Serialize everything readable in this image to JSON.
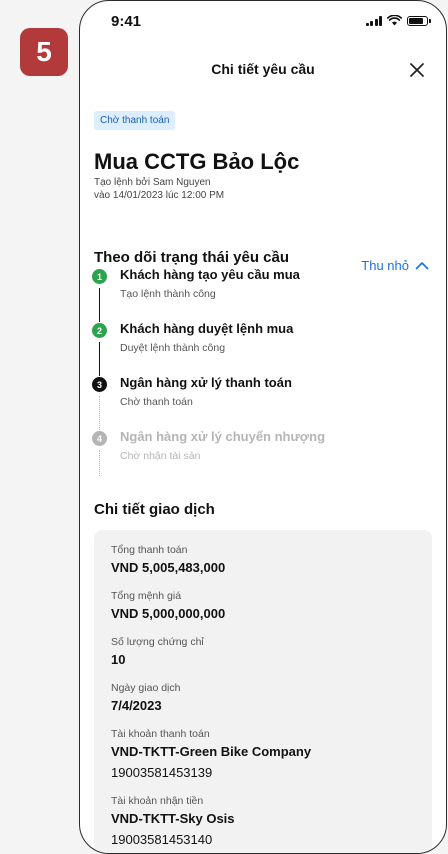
{
  "step_number": "5",
  "status_bar": {
    "time": "9:41",
    "battery_level": 0.85
  },
  "nav": {
    "title": "Chi tiết yêu cầu",
    "close_icon": "close-icon"
  },
  "request": {
    "status_badge": "Chờ thanh toán",
    "title": "Mua CCTG Bảo Lộc",
    "created_by": "Tạo lệnh bởi Sam Nguyen",
    "created_at": "vào 14/01/2023 lúc 12:00 PM"
  },
  "tracking": {
    "title": "Theo dõi trạng thái yêu cầu",
    "collapse_label": "Thu nhỏ",
    "steps": [
      {
        "number": "1",
        "title": "Khách hàng tạo yêu cầu mua",
        "subtitle": "Tạo lệnh thành công",
        "state": "done"
      },
      {
        "number": "2",
        "title": "Khách hàng duyệt lệnh mua",
        "subtitle": "Duyệt lệnh thành công",
        "state": "done"
      },
      {
        "number": "3",
        "title": "Ngân hàng xử lý thanh toán",
        "subtitle": "Chờ thanh toán",
        "state": "current"
      },
      {
        "number": "4",
        "title": "Ngân hàng xử lý chuyển nhượng",
        "subtitle": "Chờ nhận tài sản",
        "state": "pending"
      }
    ]
  },
  "details": {
    "title": "Chi tiết giao dịch",
    "fields": [
      {
        "label": "Tổng thanh toán",
        "value": "VND 5,005,483,000"
      },
      {
        "label": "Tổng mệnh giá",
        "value": "VND 5,000,000,000"
      },
      {
        "label": "Số lượng chứng chỉ",
        "value": "10"
      },
      {
        "label": "Ngày giao dịch",
        "value": "7/4/2023"
      },
      {
        "label": "Tài khoản thanh toán",
        "value": "VND-TKTT-Green Bike Company",
        "extra": "19003581453139"
      },
      {
        "label": "Tài khoản nhận tiền",
        "value": "VND-TKTT-Sky Osis",
        "extra": "19003581453140"
      }
    ]
  },
  "colors": {
    "step_badge": "#b23a3a",
    "done": "#2ca44e",
    "current": "#111111",
    "pending": "#b5b5b5",
    "link": "#1a73e8",
    "status_badge_bg": "#dceeff"
  }
}
